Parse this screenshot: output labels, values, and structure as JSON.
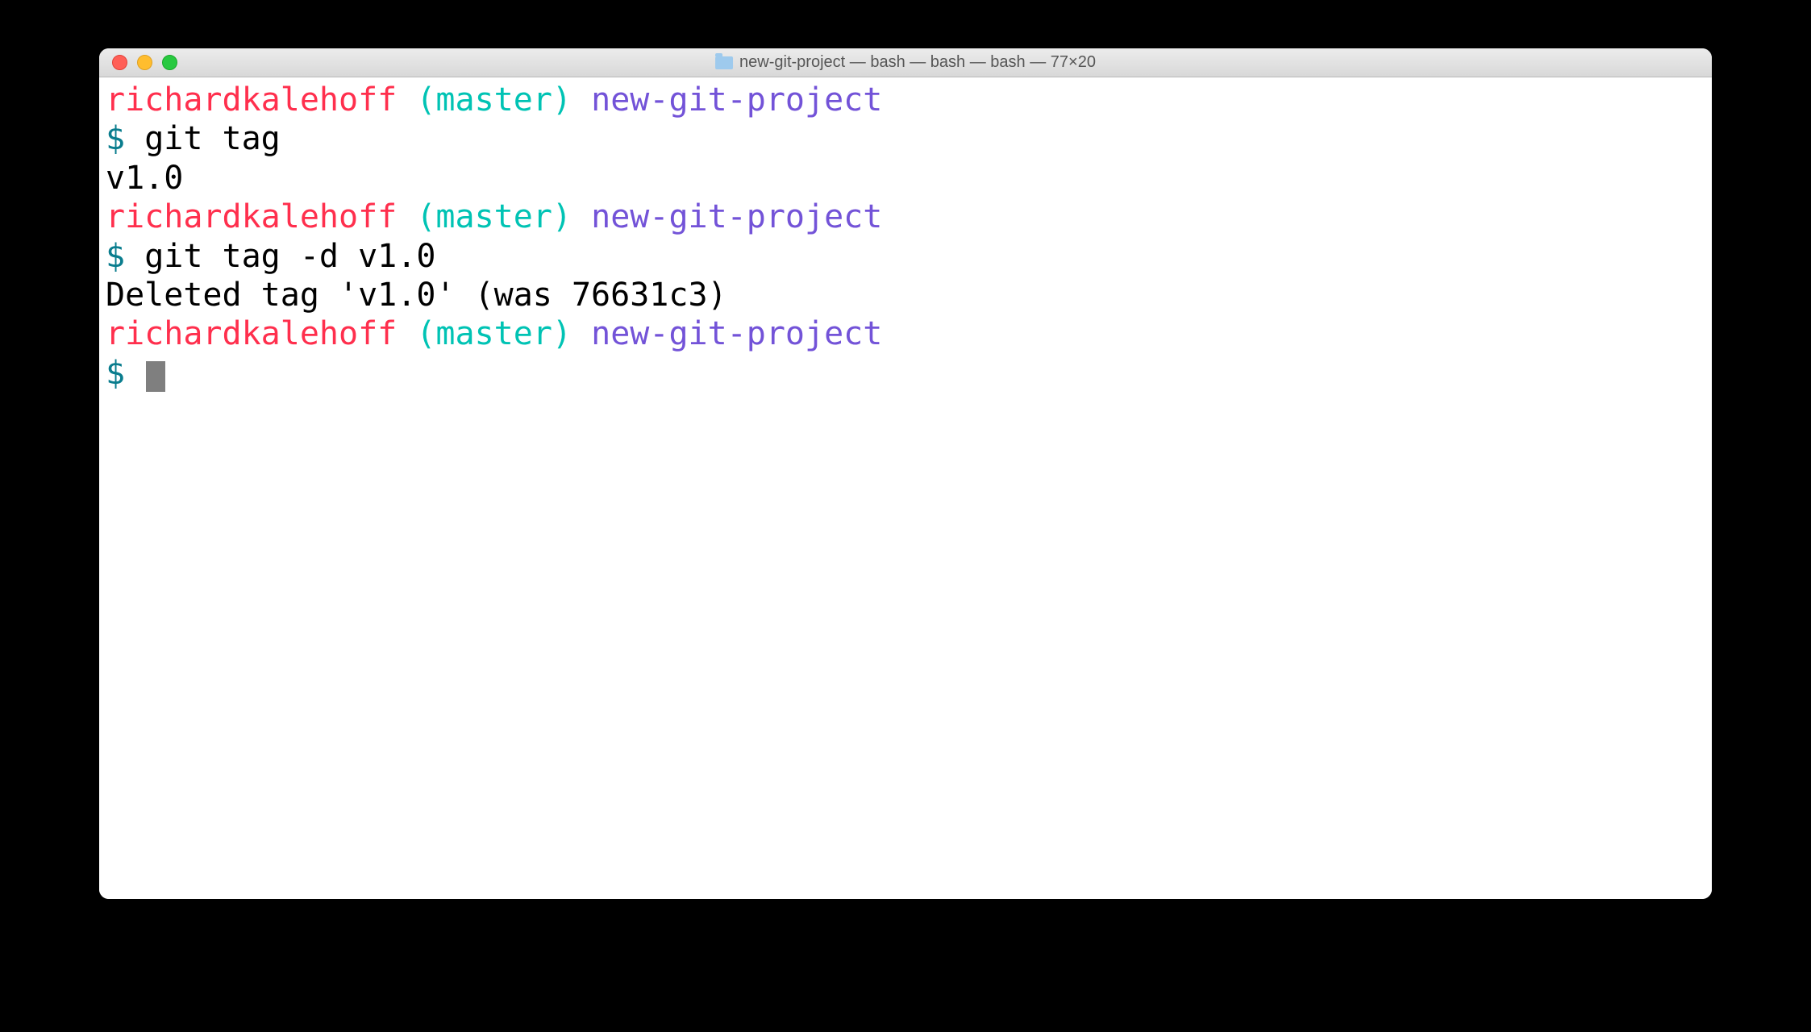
{
  "window": {
    "title": "new-git-project — bash — bash — bash — 77×20"
  },
  "prompt": {
    "user": "richardkalehoff",
    "branch_open": "(",
    "branch": "master",
    "branch_close": ")",
    "project": "new-git-project",
    "symbol": "$"
  },
  "session": {
    "cmd1": "git tag",
    "out1": "v1.0",
    "cmd2": "git tag -d v1.0",
    "out2": "Deleted tag 'v1.0' (was 76631c3)"
  }
}
